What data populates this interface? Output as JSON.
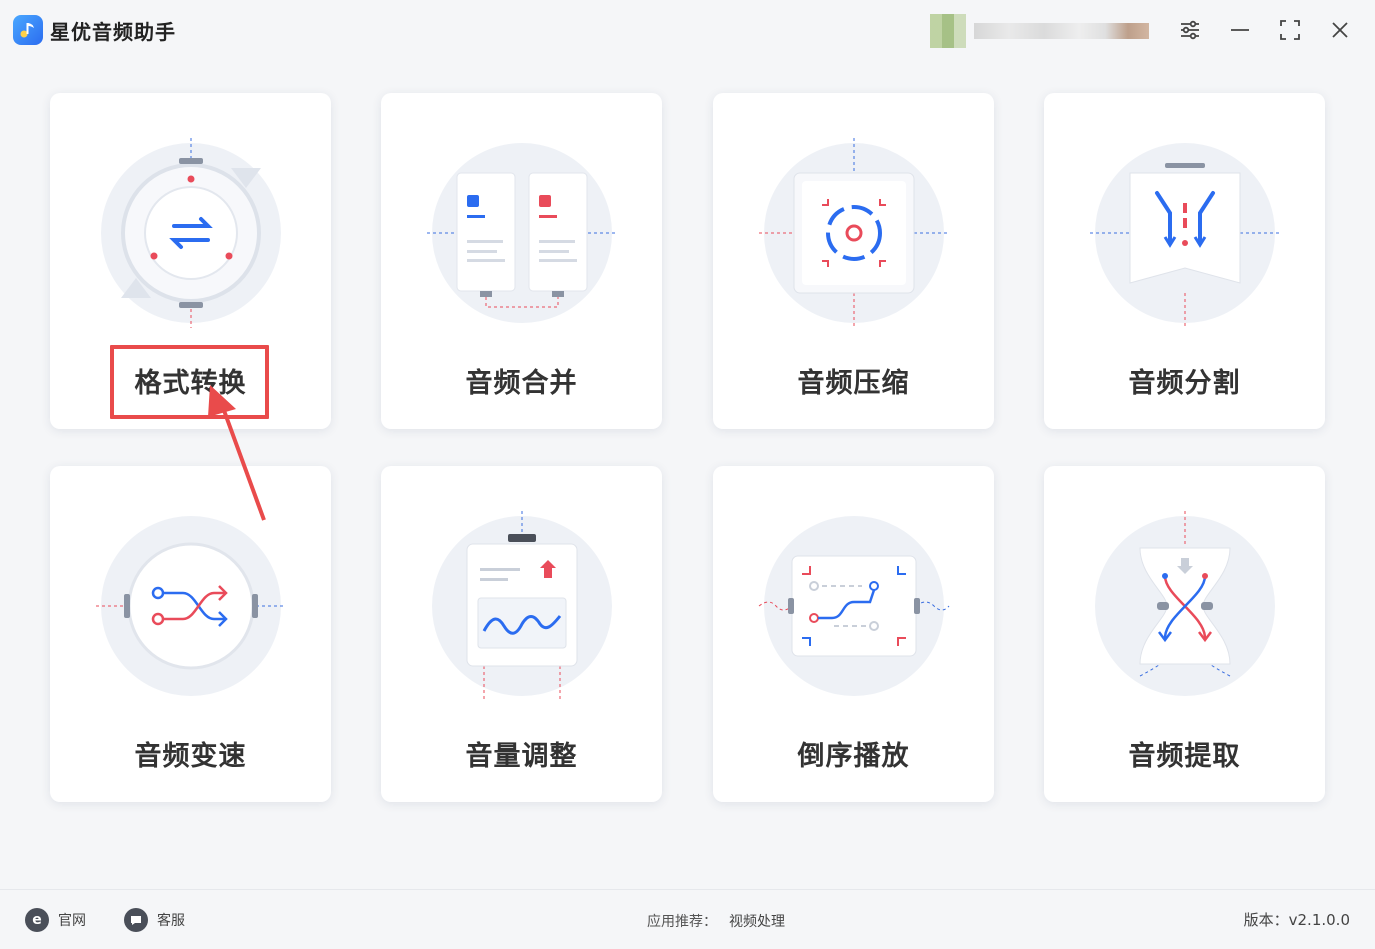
{
  "app": {
    "title": "星优音频助手",
    "accent_color": "#2b6cf0",
    "highlight_color": "#e94b4b"
  },
  "window_controls": {
    "settings_icon": "sliders-icon",
    "minimize_icon": "minimize-icon",
    "maximize_icon": "maximize-icon",
    "close_icon": "close-icon"
  },
  "cards": [
    {
      "label": "格式转换",
      "icon": "format-convert-icon"
    },
    {
      "label": "音频合并",
      "icon": "audio-merge-icon"
    },
    {
      "label": "音频压缩",
      "icon": "audio-compress-icon"
    },
    {
      "label": "音频分割",
      "icon": "audio-split-icon"
    },
    {
      "label": "音频变速",
      "icon": "audio-speed-icon"
    },
    {
      "label": "音量调整",
      "icon": "volume-adjust-icon"
    },
    {
      "label": "倒序播放",
      "icon": "reverse-play-icon"
    },
    {
      "label": "音频提取",
      "icon": "audio-extract-icon"
    }
  ],
  "footer": {
    "website_label": "官网",
    "support_label": "客服",
    "recommend_label": "应用推荐：",
    "recommend_app": "视频处理",
    "version_label": "版本：v2.1.0.0"
  }
}
